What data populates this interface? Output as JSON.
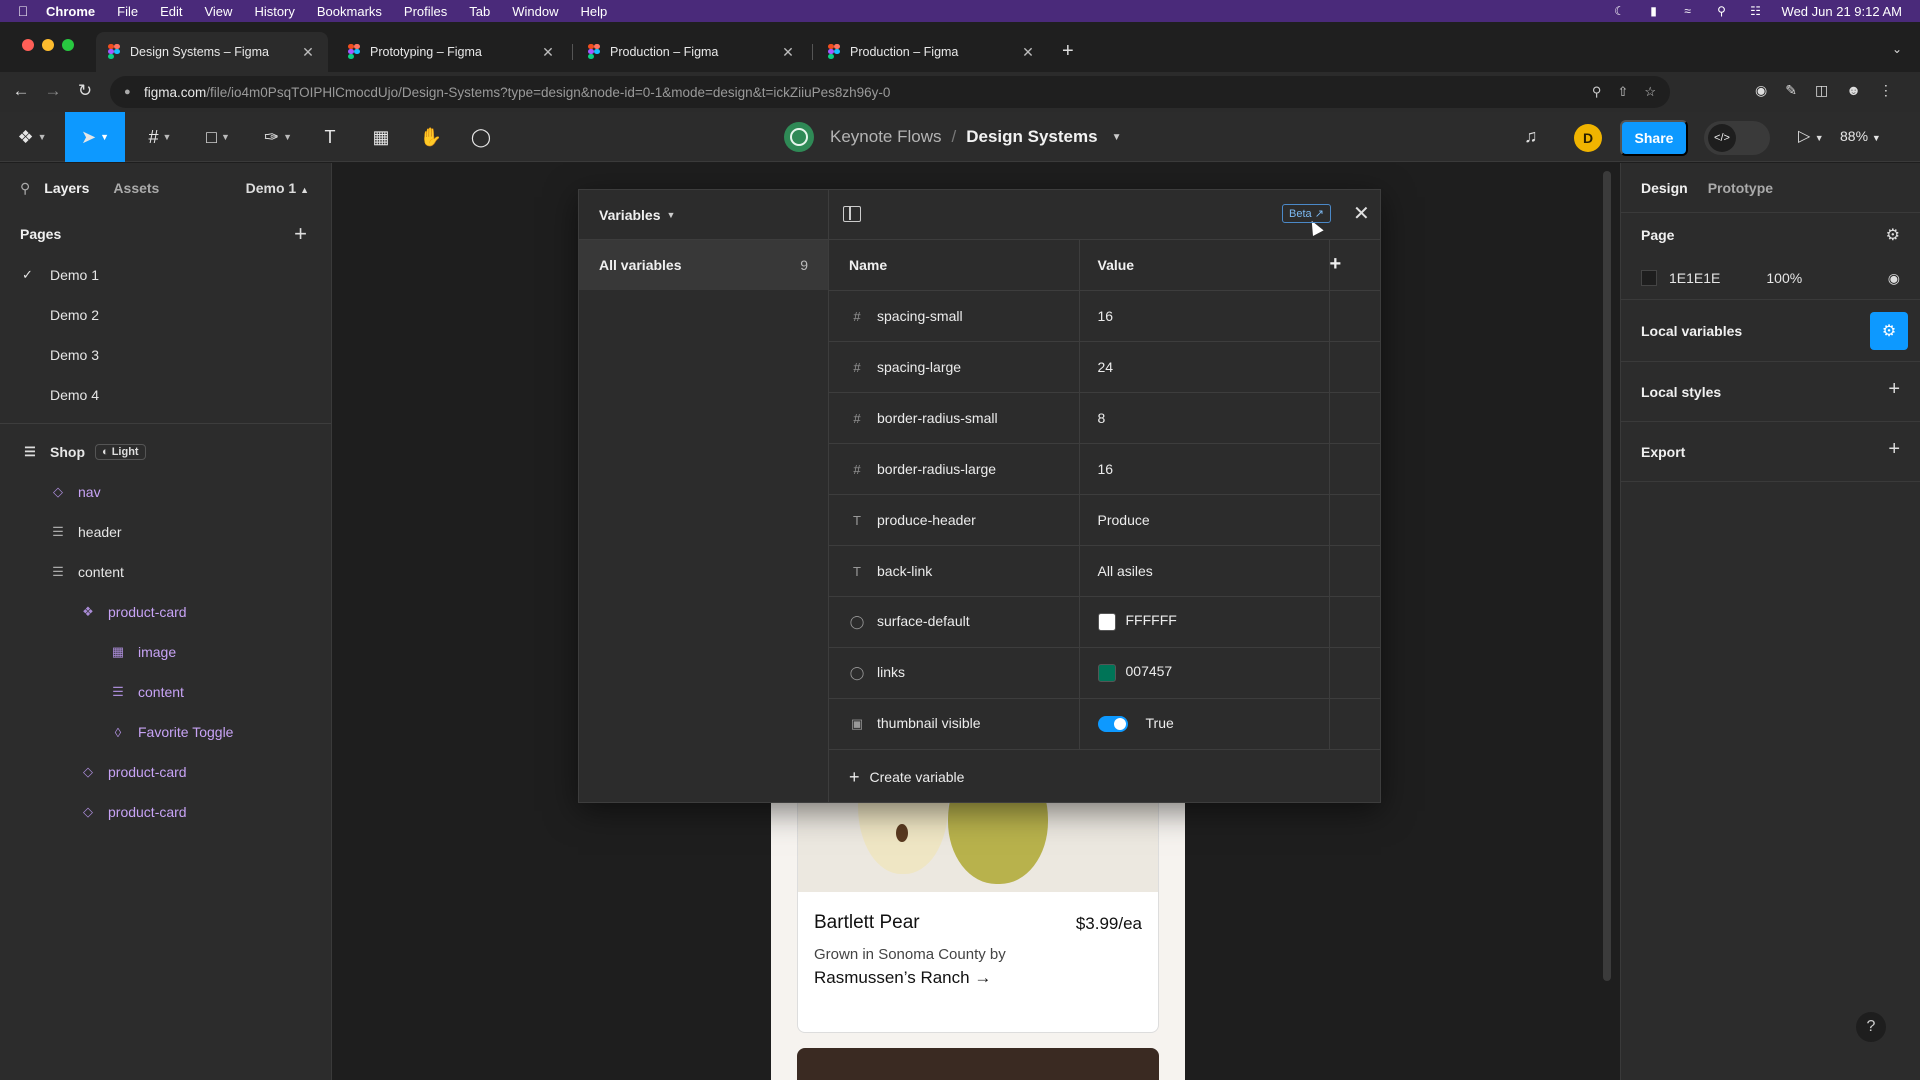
{
  "mac_menu": {
    "app": "Chrome",
    "items": [
      "File",
      "Edit",
      "View",
      "History",
      "Bookmarks",
      "Profiles",
      "Tab",
      "Window",
      "Help"
    ],
    "datetime": "Wed Jun 21  9:12 AM"
  },
  "browser": {
    "tabs": [
      {
        "title": "Design Systems – Figma",
        "active": true
      },
      {
        "title": "Prototyping – Figma",
        "active": false
      },
      {
        "title": "Production – Figma",
        "active": false
      },
      {
        "title": "Production – Figma",
        "active": false
      }
    ],
    "url_host": "figma.com",
    "url_path": "/file/io4m0PsqTOIPHlCmocdUjo/Design-Systems?type=design&node-id=0-1&mode=design&t=ickZiiuPes8zh96y-0"
  },
  "toolbar": {
    "project": "Keynote Flows",
    "separator": "/",
    "file": "Design Systems",
    "avatar_initial": "D",
    "share_label": "Share",
    "zoom": "88%"
  },
  "left_panel": {
    "tabs": [
      "Layers",
      "Assets"
    ],
    "current_page": "Demo 1",
    "pages_header": "Pages",
    "pages": [
      "Demo 1",
      "Demo 2",
      "Demo 3",
      "Demo 4"
    ],
    "layers": [
      {
        "name": "Shop",
        "icon": "frame-icon",
        "indent": 0,
        "badge": "Light",
        "component": false,
        "bold": true
      },
      {
        "name": "nav",
        "icon": "instance-icon",
        "indent": 1,
        "component": true
      },
      {
        "name": "header",
        "icon": "autolayout-icon",
        "indent": 1,
        "component": false
      },
      {
        "name": "content",
        "icon": "autolayout-icon",
        "indent": 1,
        "component": false
      },
      {
        "name": "product-card",
        "icon": "component-icon",
        "indent": 2,
        "component": true
      },
      {
        "name": "image",
        "icon": "image-icon",
        "indent": 3,
        "component": true
      },
      {
        "name": "content",
        "icon": "autolayout-icon",
        "indent": 3,
        "component": true
      },
      {
        "name": "Favorite Toggle",
        "icon": "instance-icon",
        "indent": 3,
        "component": true
      },
      {
        "name": "product-card",
        "icon": "instance-icon",
        "indent": 2,
        "component": true
      },
      {
        "name": "product-card",
        "icon": "instance-icon",
        "indent": 2,
        "component": true
      }
    ]
  },
  "variables_modal": {
    "title": "Variables",
    "collection": "All variables",
    "count": "9",
    "beta_label": "Beta",
    "col_name": "Name",
    "col_value": "Value",
    "create_label": "Create variable",
    "rows": [
      {
        "type": "number",
        "name": "spacing-small",
        "value": "16"
      },
      {
        "type": "number",
        "name": "spacing-large",
        "value": "24"
      },
      {
        "type": "number",
        "name": "border-radius-small",
        "value": "8"
      },
      {
        "type": "number",
        "name": "border-radius-large",
        "value": "16"
      },
      {
        "type": "string",
        "name": "produce-header",
        "value": "Produce"
      },
      {
        "type": "string",
        "name": "back-link",
        "value": "All asiles"
      },
      {
        "type": "color",
        "name": "surface-default",
        "value": "FFFFFF",
        "color": "#FFFFFF"
      },
      {
        "type": "color",
        "name": "links",
        "value": "007457",
        "color": "#007457"
      },
      {
        "type": "boolean",
        "name": "thumbnail visible",
        "value": "True"
      }
    ]
  },
  "product_card": {
    "name": "Bartlett Pear",
    "price": "$3.99/ea",
    "origin": "Grown in Sonoma County by",
    "farm": "Rasmussen’s Ranch →"
  },
  "right_panel": {
    "tabs": [
      "Design",
      "Prototype"
    ],
    "page_label": "Page",
    "bg_color": "1E1E1E",
    "bg_opacity": "100%",
    "local_variables": "Local variables",
    "local_styles": "Local styles",
    "export": "Export"
  },
  "colors": {
    "accent": "#0d99ff",
    "menubar": "#4a2a7a",
    "component": "#c7a3f5"
  }
}
